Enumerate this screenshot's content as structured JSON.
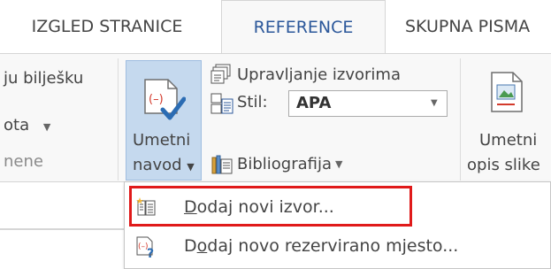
{
  "tabs": [
    {
      "label": "IZGLED STRANICE",
      "active": false
    },
    {
      "label": "REFERENCE",
      "active": true
    },
    {
      "label": "SKUPNA PISMA",
      "active": false
    }
  ],
  "ribbon": {
    "footnotes_group": {
      "line1": "ju bilješku",
      "line2": "ota",
      "line3": "nene"
    },
    "insert_citation": {
      "line1": "Umetni",
      "line2": "navod"
    },
    "manage_sources_label": "Upravljanje izvorima",
    "style_label": "Stil:",
    "style_value": "APA",
    "bibliography_label": "Bibliografija",
    "insert_caption": {
      "line1": "Umetni",
      "line2": "opis slike"
    }
  },
  "menu": {
    "items": [
      {
        "pre": "",
        "accel": "D",
        "post": "odaj novi izvor...",
        "highlighted": true
      },
      {
        "pre": "D",
        "accel": "o",
        "post": "daj novo rezervirano mjesto...",
        "highlighted": false
      }
    ]
  },
  "colors": {
    "accent": "#2b579a",
    "highlight_border": "#e01a1a",
    "citation_button_bg": "#c5d9ee"
  }
}
